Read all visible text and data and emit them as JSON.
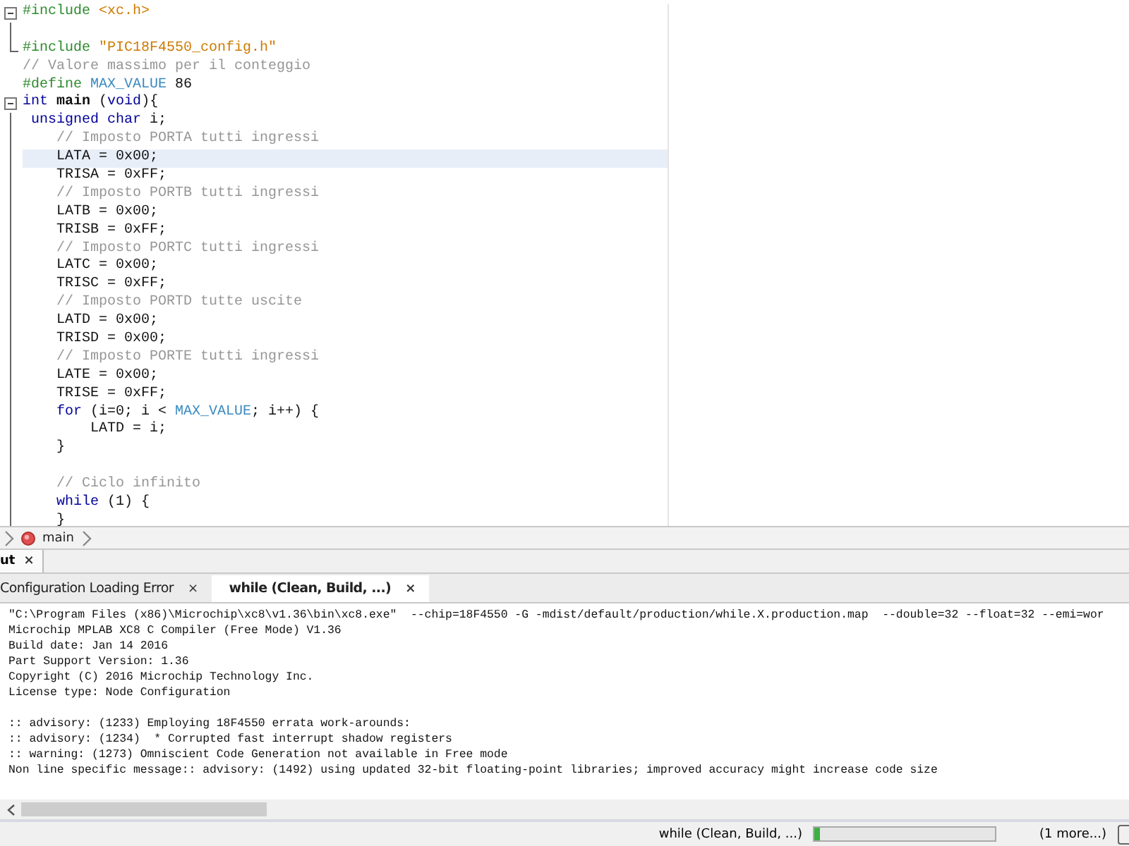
{
  "editor": {
    "lines": [
      {
        "kind": "opener",
        "highlighted": false,
        "segments": [
          {
            "kind": "pp",
            "text": "#include"
          },
          {
            "kind": "str",
            "text": " <xc.h>"
          }
        ]
      },
      {
        "kind": "inner",
        "highlighted": false
      },
      {
        "kind": "closer",
        "highlighted": false,
        "segments": [
          {
            "kind": "pp",
            "text": "#include"
          },
          {
            "kind": "str",
            "text": " \"PIC18F4550_config.h\""
          }
        ]
      },
      {
        "kind": "outer",
        "highlighted": false,
        "segments": [
          {
            "kind": "comment",
            "text": "// Valore massimo per il conteggio"
          }
        ]
      },
      {
        "kind": "outer",
        "highlighted": false,
        "segments": [
          {
            "kind": "pp",
            "text": "#define"
          },
          {
            "kind": "macro",
            "text": " MAX_VALUE"
          },
          {
            "kind": "plain",
            "text": " 86"
          }
        ]
      },
      {
        "kind": "opener",
        "highlighted": false,
        "segments": [
          {
            "kind": "kw",
            "text": "int"
          },
          {
            "kind": "fn",
            "text": " main"
          },
          {
            "kind": "plain",
            "text": " ("
          },
          {
            "kind": "kw",
            "text": "void"
          },
          {
            "kind": "plain",
            "text": "){"
          }
        ]
      },
      {
        "kind": "inner",
        "highlighted": false,
        "segments": [
          {
            "kind": "kw",
            "text": " unsigned"
          },
          {
            "kind": "kw",
            "text": " char"
          },
          {
            "kind": "plain",
            "text": " i;"
          }
        ]
      },
      {
        "kind": "inner",
        "highlighted": false,
        "segments": [
          {
            "kind": "comment",
            "text": "    // Imposto PORTA tutti ingressi"
          }
        ]
      },
      {
        "kind": "inner",
        "highlighted": true,
        "segments": [
          {
            "kind": "plain",
            "text": "    LATA = 0x00;"
          }
        ]
      },
      {
        "kind": "inner",
        "highlighted": false,
        "segments": [
          {
            "kind": "plain",
            "text": "    TRISA = 0xFF;"
          }
        ]
      },
      {
        "kind": "inner",
        "highlighted": false,
        "segments": [
          {
            "kind": "comment",
            "text": "    // Imposto PORTB tutti ingressi"
          }
        ]
      },
      {
        "kind": "inner",
        "highlighted": false,
        "segments": [
          {
            "kind": "plain",
            "text": "    LATB = 0x00;"
          }
        ]
      },
      {
        "kind": "inner",
        "highlighted": false,
        "segments": [
          {
            "kind": "plain",
            "text": "    TRISB = 0xFF;"
          }
        ]
      },
      {
        "kind": "inner",
        "highlighted": false,
        "segments": [
          {
            "kind": "comment",
            "text": "    // Imposto PORTC tutti ingressi"
          }
        ]
      },
      {
        "kind": "inner",
        "highlighted": false,
        "segments": [
          {
            "kind": "plain",
            "text": "    LATC = 0x00;"
          }
        ]
      },
      {
        "kind": "inner",
        "highlighted": false,
        "segments": [
          {
            "kind": "plain",
            "text": "    TRISC = 0xFF;"
          }
        ]
      },
      {
        "kind": "inner",
        "highlighted": false,
        "segments": [
          {
            "kind": "comment",
            "text": "    // Imposto PORTD tutte uscite"
          }
        ]
      },
      {
        "kind": "inner",
        "highlighted": false,
        "segments": [
          {
            "kind": "plain",
            "text": "    LATD = 0x00;"
          }
        ]
      },
      {
        "kind": "inner",
        "highlighted": false,
        "segments": [
          {
            "kind": "plain",
            "text": "    TRISD = 0x00;"
          }
        ]
      },
      {
        "kind": "inner",
        "highlighted": false,
        "segments": [
          {
            "kind": "comment",
            "text": "    // Imposto PORTE tutti ingressi"
          }
        ]
      },
      {
        "kind": "inner",
        "highlighted": false,
        "segments": [
          {
            "kind": "plain",
            "text": "    LATE = 0x00;"
          }
        ]
      },
      {
        "kind": "inner",
        "highlighted": false,
        "segments": [
          {
            "kind": "plain",
            "text": "    TRISE = 0xFF;"
          }
        ]
      },
      {
        "kind": "inner",
        "highlighted": false,
        "segments": [
          {
            "kind": "kw",
            "text": "    for"
          },
          {
            "kind": "plain",
            "text": " (i=0; i < "
          },
          {
            "kind": "macro",
            "text": "MAX_VALUE"
          },
          {
            "kind": "plain",
            "text": "; i++) {"
          }
        ]
      },
      {
        "kind": "inner",
        "highlighted": false,
        "segments": [
          {
            "kind": "plain",
            "text": "        LATD = i;"
          }
        ]
      },
      {
        "kind": "inner",
        "highlighted": false,
        "segments": [
          {
            "kind": "plain",
            "text": "    }"
          }
        ]
      },
      {
        "kind": "inner",
        "highlighted": false
      },
      {
        "kind": "inner",
        "highlighted": false,
        "segments": [
          {
            "kind": "comment",
            "text": "    // Ciclo infinito"
          }
        ]
      },
      {
        "kind": "inner",
        "highlighted": false,
        "segments": [
          {
            "kind": "kw",
            "text": "    while"
          },
          {
            "kind": "plain",
            "text": " (1) {"
          }
        ]
      },
      {
        "kind": "inner",
        "highlighted": false,
        "segments": [
          {
            "kind": "plain",
            "text": "    }"
          }
        ]
      }
    ]
  },
  "breadcrumb": {
    "items": [
      "main"
    ]
  },
  "output": {
    "title": "ut",
    "close": "×",
    "tabs": [
      {
        "label": "Configuration Loading Error",
        "close": "×",
        "selected": false
      },
      {
        "label": "while (Clean, Build, ...)",
        "close": "×",
        "selected": true
      }
    ],
    "groups": [
      [
        "\"C:\\Program Files (x86)\\Microchip\\xc8\\v1.36\\bin\\xc8.exe\"  --chip=18F4550 -G -mdist/default/production/while.X.production.map  --double=32 --float=32 --emi=wor",
        "Microchip MPLAB XC8 C Compiler (Free Mode) V1.36",
        "Build date: Jan 14 2016",
        "Part Support Version: 1.36",
        "Copyright (C) 2016 Microchip Technology Inc.",
        "License type: Node Configuration"
      ],
      [
        ":: advisory: (1233) Employing 18F4550 errata work-arounds:",
        ":: advisory: (1234)  * Corrupted fast interrupt shadow registers",
        ":: warning: (1273) Omniscient Code Generation not available in Free mode",
        "Non line specific message:: advisory: (1492) using updated 32-bit floating-point libraries; improved accuracy might increase code size"
      ]
    ]
  },
  "status_bar": {
    "task": "while (Clean, Build, ...)",
    "level": 0.03,
    "more": "(1 more...)"
  }
}
